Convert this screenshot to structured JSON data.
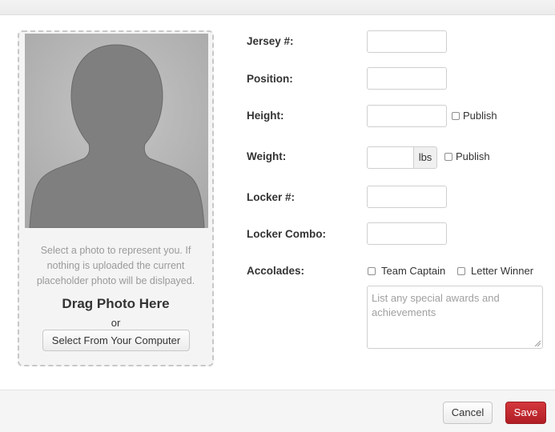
{
  "photo": {
    "help_text_line1": "Select a photo to represent you. If",
    "help_text_line2": "nothing is uploaded the current",
    "help_text_line3": "placeholder photo will be dislpayed.",
    "drag_title": "Drag Photo Here",
    "or_text": "or",
    "select_button": "Select From Your Computer"
  },
  "form": {
    "jersey_label": "Jersey #:",
    "position_label": "Position:",
    "height_label": "Height:",
    "weight_label": "Weight:",
    "locker_label": "Locker #:",
    "locker_combo_label": "Locker Combo:",
    "accolades_label": "Accolades:",
    "publish_label": "Publish",
    "weight_unit": "lbs",
    "team_captain_label": "Team Captain",
    "letter_winner_label": "Letter Winner",
    "accolades_placeholder": "List any special awards and achievements",
    "values": {
      "jersey": "",
      "position": "",
      "height": "",
      "weight": "",
      "locker": "",
      "locker_combo": "",
      "accolades": ""
    },
    "checkboxes": {
      "height_publish": false,
      "weight_publish": false,
      "team_captain": false,
      "letter_winner": false
    }
  },
  "footer": {
    "cancel_label": "Cancel",
    "save_label": "Save"
  },
  "colors": {
    "save_button": "#b01e24",
    "placeholder_bg": "#b9b9b9",
    "silhouette": "#7f7f7f"
  }
}
